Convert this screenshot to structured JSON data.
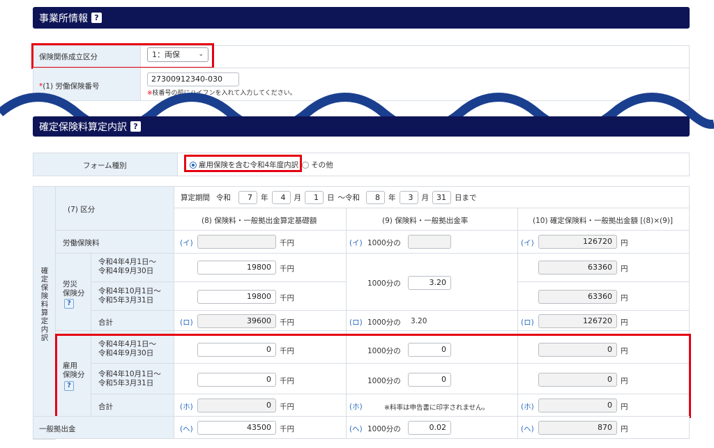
{
  "office_section": {
    "title": "事業所情報",
    "help": "?",
    "insurance_type": {
      "label": "保険関係成立区分",
      "value": "1：両保"
    },
    "labor_number": {
      "label": "(1) 労働保険番号",
      "required_mark": "*",
      "value": "27300912340-030",
      "note_mark": "※",
      "note": "枝番号の前にハイフンを入れて入力してください。"
    }
  },
  "calc_section": {
    "title": "確定保険料算定内訳",
    "help": "?",
    "form_type": {
      "label": "フォーム種別",
      "options": [
        "雇用保険を含む令和4年度内訳",
        "その他"
      ],
      "selected": 0
    },
    "period": {
      "label": "算定期間",
      "era1": "令和",
      "y1": "7",
      "y_unit": "年",
      "m1": "4",
      "m_unit": "月",
      "d1": "1",
      "d_unit": "日",
      "tilde": "～令和",
      "y2": "8",
      "m2": "3",
      "d2": "31",
      "until": "日まで"
    },
    "side_label": "確定保険料算定内訳",
    "kubun": "(7) 区分",
    "col_headers": [
      "(8) 保険料・一般拠出金算定基礎額",
      "(9) 保険料・一般拠出金率",
      "(10) 確定保険料・一般拠出金額 [(8)×(9)]"
    ],
    "units": {
      "senen": "千円",
      "en": "円",
      "rate_prefix": "1000分の"
    },
    "rows": {
      "labor": {
        "label": "労働保険料",
        "mark": "(イ)",
        "base": "",
        "rate": "",
        "amount": "126720"
      },
      "rousai_group": {
        "label": "労災\n保険分",
        "help": "?"
      },
      "rousai_1": {
        "period": "令和4年4月1日～\n令和4年9月30日",
        "base": "19800",
        "amount": "63360"
      },
      "rousai_2": {
        "period": "令和4年10月1日～\n令和5年3月31日",
        "base": "19800",
        "amount": "63360"
      },
      "rousai_rate": "3.20",
      "rousai_total": {
        "label": "合計",
        "mark": "(ロ)",
        "base": "39600",
        "rate": "3.20",
        "amount": "126720"
      },
      "koyou_group": {
        "label": "雇用\n保険分",
        "help": "?"
      },
      "koyou_1": {
        "period": "令和4年4月1日～\n令和4年9月30日",
        "base": "0",
        "rate": "0",
        "amount": "0"
      },
      "koyou_2": {
        "period": "令和4年10月1日～\n令和5年3月31日",
        "base": "0",
        "rate": "0",
        "amount": "0"
      },
      "koyou_total": {
        "label": "合計",
        "mark": "(ホ)",
        "base": "0",
        "note": "※料率は申告書に印字されません。",
        "amount": "0"
      },
      "general": {
        "label": "一般拠出金",
        "mark": "(ヘ)",
        "base": "43500",
        "rate": "0.02",
        "amount": "870"
      }
    }
  },
  "colors": {
    "header_bg": "#0e1557",
    "label_bg": "#e8f0f8",
    "highlight": "#e50012",
    "wave": "#1b3f8f",
    "link_blue": "#2a6ac0"
  }
}
